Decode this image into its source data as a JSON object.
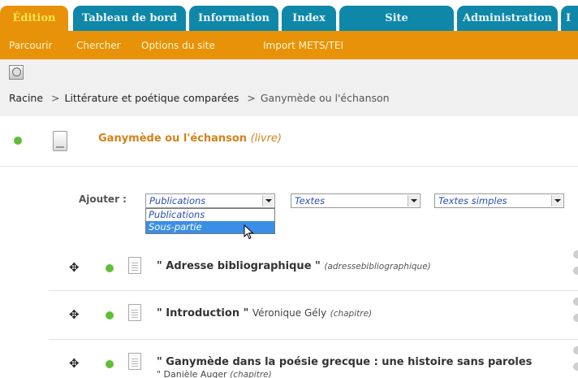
{
  "tabs": [
    {
      "label": "Édition"
    },
    {
      "label": "Tableau de bord"
    },
    {
      "label": "Information"
    },
    {
      "label": "Index"
    },
    {
      "label": "Site"
    },
    {
      "label": "Administration"
    },
    {
      "label": "I"
    }
  ],
  "submenu": {
    "browse": "Parcourir",
    "search": "Chercher",
    "site_options": "Options du site",
    "import": "Import METS/TEI"
  },
  "breadcrumb": {
    "root": "Racine",
    "level1": "Littérature et poétique comparées",
    "current": "Ganymède ou l'échanson",
    "separator": ">"
  },
  "publication": {
    "title": "Ganymède ou l'échanson",
    "type": "(livre)",
    "status_color": "#5fbf35"
  },
  "add": {
    "label": "Ajouter :",
    "select1_value": "Publications",
    "select2_value": "Textes",
    "select3_value": "Textes simples",
    "dropdown_options": [
      "Publications",
      "Sous-partie"
    ],
    "dropdown_highlighted": "Sous-partie"
  },
  "entries": [
    {
      "title": "\" Adresse bibliographique \"",
      "author": "",
      "type": "(adressebibliographique)",
      "line2": ""
    },
    {
      "title": "\" Introduction \"",
      "author": "Véronique Gély",
      "type": "(chapitre)",
      "line2": ""
    },
    {
      "title": "\" Ganymède dans la poésie grecque : une histoire sans paroles",
      "author": "",
      "type": "",
      "line2": "\" Danièle Auger",
      "line2_type": "(chapitre)"
    }
  ],
  "colors": {
    "tab_blue": "#0f87a8",
    "tab_active_orange": "#e8920a",
    "active_tab_text": "#ffe44d",
    "title_orange": "#d4821a",
    "status_green": "#5fbf35"
  }
}
